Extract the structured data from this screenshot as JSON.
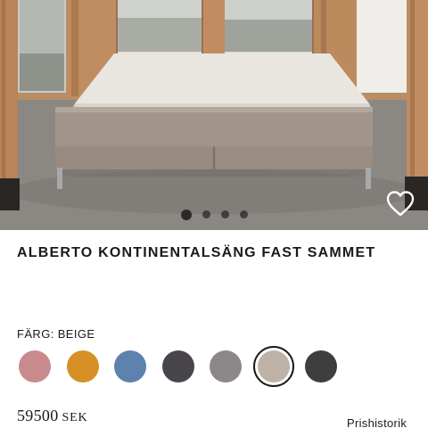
{
  "product": {
    "title": "ALBERTO KONTINENTALSÄNG FAST SAMMET",
    "image_alt": "Alberto kontinentalsäng",
    "gallery_dots": 4,
    "active_dot": 0
  },
  "color": {
    "label": "FÄRG: BEIGE",
    "swatches": [
      {
        "hex": "#c98a8e",
        "selected": false
      },
      {
        "hex": "#d69026",
        "selected": false
      },
      {
        "hex": "#5c82ad",
        "selected": false
      },
      {
        "hex": "#48464a",
        "selected": false
      },
      {
        "hex": "#8c8887",
        "selected": false
      },
      {
        "hex": "#beb2a6",
        "selected": true
      },
      {
        "hex": "#3f3d3e",
        "selected": false
      }
    ]
  },
  "price": {
    "amount": "59500",
    "currency": "SEK"
  },
  "links": {
    "price_history": "Prishistorik"
  },
  "icons": {
    "favorite": "heart-icon"
  }
}
